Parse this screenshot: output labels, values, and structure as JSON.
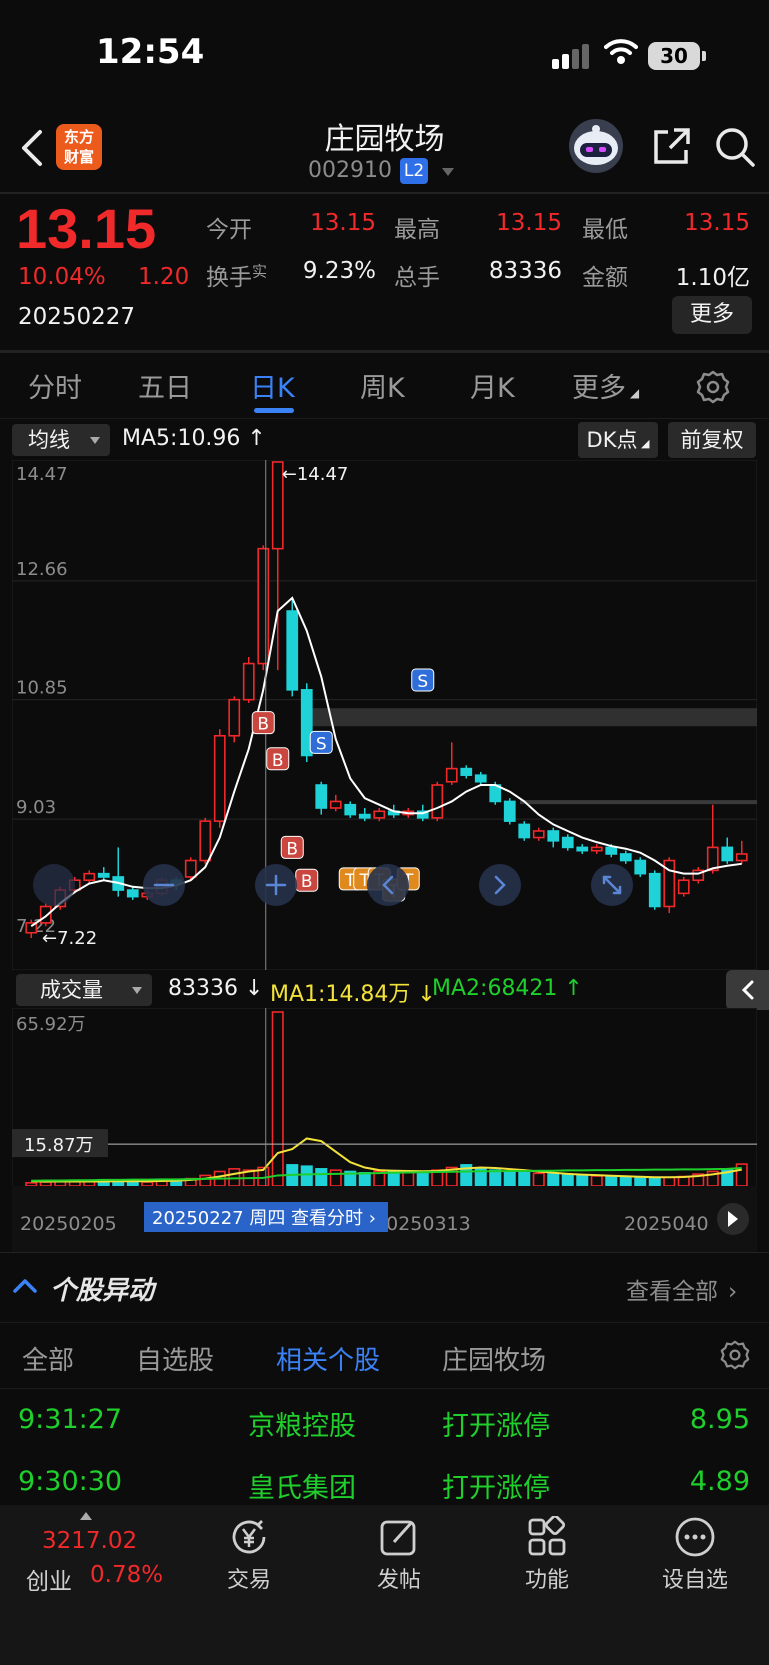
{
  "status_bar": {
    "time": "12:54",
    "battery": "30"
  },
  "header": {
    "logo_line1": "东方",
    "logo_line2": "财富",
    "title": "庄园牧场",
    "code": "002910",
    "level_badge": "L2"
  },
  "quote": {
    "price": "13.15",
    "change_pct": "10.04%",
    "change": "1.20",
    "date": "20250227",
    "fields": [
      {
        "label": "今开",
        "value": "13.15"
      },
      {
        "label": "最高",
        "value": "13.15"
      },
      {
        "label": "最低",
        "value": "13.15"
      },
      {
        "label": "换手",
        "label_sup": "实",
        "value": "9.23%"
      },
      {
        "label": "总手",
        "value": "83336"
      },
      {
        "label": "金额",
        "value": "1.10亿"
      }
    ],
    "more_label": "更多"
  },
  "tabs": [
    "分时",
    "五日",
    "日K",
    "周K",
    "月K",
    "更多"
  ],
  "active_tab": "日K",
  "kline": {
    "ma_selector": "均线",
    "ma5_label": "MA5:10.96 ↑",
    "dk_button": "DK点",
    "adjust_button": "前复权",
    "y_ticks": [
      "14.47",
      "12.66",
      "10.85",
      "9.03",
      "7.22"
    ],
    "high_marker": "14.47",
    "low_marker": "7.22",
    "signal_buy": "B",
    "signal_sell": "S",
    "signal_t": "T",
    "ma_color": "#ffffff"
  },
  "volume": {
    "selector": "成交量",
    "value": "83336 ↓",
    "ma1": "MA1:14.84万 ↓",
    "ma2": "MA2:68421 ↑",
    "y_top": "65.92万",
    "crosshair_value": "15.87万",
    "dates": [
      "20250205",
      "20250313",
      "2025040"
    ],
    "tooltip": "20250227 周四 查看分时",
    "ma1_color": "#f2e23a",
    "ma2_color": "#1fcf2c"
  },
  "colors": {
    "up": "#f0292a",
    "down": "#1ed2d8",
    "accent": "#3b82f6"
  },
  "chart_data": {
    "type": "candlestick",
    "title": "",
    "ylim": [
      7.22,
      14.47
    ],
    "x": [
      1,
      2,
      3,
      4,
      5,
      6,
      7,
      8,
      9,
      10,
      11,
      12,
      13,
      14,
      15,
      16,
      17,
      18,
      19,
      20,
      21,
      22,
      23,
      24,
      25,
      26,
      27,
      28,
      29,
      30,
      31,
      32,
      33,
      34,
      35,
      36,
      37,
      38,
      39,
      40,
      41,
      42,
      43,
      44,
      45,
      46,
      47,
      48,
      49,
      50
    ],
    "series": [
      {
        "name": "",
        "open": [
          7.3,
          7.45,
          7.7,
          7.95,
          8.1,
          8.2,
          8.15,
          7.95,
          7.85,
          7.9,
          8.1,
          8.15,
          8.4,
          9.0,
          10.3,
          10.85,
          11.4,
          13.15,
          12.2,
          11.0,
          9.55,
          9.2,
          9.25,
          9.1,
          9.05,
          9.15,
          9.1,
          9.15,
          9.05,
          9.6,
          9.8,
          9.7,
          9.55,
          9.3,
          8.95,
          8.75,
          8.85,
          8.75,
          8.6,
          8.55,
          8.6,
          8.5,
          8.4,
          8.2,
          7.7,
          7.9,
          8.1,
          8.25,
          8.6,
          8.4
        ],
        "close": [
          7.45,
          7.7,
          7.95,
          8.1,
          8.2,
          8.15,
          7.95,
          7.85,
          7.9,
          8.1,
          8.05,
          8.4,
          9.0,
          10.3,
          10.85,
          11.4,
          13.15,
          14.47,
          11.0,
          10.0,
          9.2,
          9.3,
          9.1,
          9.05,
          9.15,
          9.1,
          9.15,
          9.05,
          9.55,
          9.8,
          9.7,
          9.6,
          9.3,
          9.0,
          8.75,
          8.85,
          8.7,
          8.6,
          8.55,
          8.6,
          8.5,
          8.4,
          8.2,
          7.7,
          8.4,
          8.1,
          8.25,
          8.6,
          8.4,
          8.5
        ],
        "high": [
          7.5,
          7.75,
          8.0,
          8.15,
          8.25,
          8.3,
          8.6,
          8.0,
          7.95,
          8.15,
          8.15,
          8.45,
          9.05,
          10.4,
          10.9,
          11.5,
          13.2,
          14.47,
          12.4,
          11.1,
          9.6,
          9.4,
          9.3,
          9.2,
          9.2,
          9.25,
          9.2,
          9.25,
          9.6,
          10.2,
          9.85,
          9.75,
          9.6,
          9.35,
          9.0,
          8.9,
          8.9,
          8.8,
          8.65,
          8.65,
          8.65,
          8.55,
          8.45,
          8.25,
          8.45,
          8.15,
          8.3,
          9.25,
          8.75,
          8.7
        ],
        "low": [
          7.22,
          7.4,
          7.65,
          7.9,
          8.05,
          8.1,
          7.85,
          7.8,
          7.8,
          7.85,
          7.95,
          8.1,
          8.35,
          8.9,
          10.2,
          10.8,
          11.3,
          11.3,
          10.9,
          9.9,
          9.1,
          9.15,
          9.05,
          9.0,
          9.0,
          9.05,
          9.05,
          9.0,
          9.0,
          9.55,
          9.65,
          9.55,
          9.25,
          8.95,
          8.7,
          8.7,
          8.6,
          8.55,
          8.5,
          8.5,
          8.45,
          8.35,
          8.15,
          7.65,
          7.6,
          7.85,
          8.05,
          8.2,
          8.35,
          8.35
        ]
      }
    ],
    "ma5": [
      7.4,
      7.55,
      7.75,
      7.92,
      8.05,
      8.1,
      8.06,
      8.0,
      7.98,
      7.98,
      8.02,
      8.1,
      8.3,
      8.75,
      9.45,
      10.1,
      11.0,
      12.2,
      12.4,
      11.9,
      11.2,
      10.25,
      9.65,
      9.35,
      9.25,
      9.15,
      9.12,
      9.12,
      9.2,
      9.3,
      9.45,
      9.55,
      9.55,
      9.45,
      9.3,
      9.1,
      8.95,
      8.85,
      8.75,
      8.68,
      8.62,
      8.58,
      8.52,
      8.4,
      8.25,
      8.2,
      8.2,
      8.28,
      8.32,
      8.35
    ],
    "volume": [
      1.2,
      1.5,
      1.8,
      1.6,
      2.0,
      1.9,
      1.7,
      1.3,
      1.5,
      1.8,
      2.2,
      2.8,
      4.0,
      5.5,
      6.5,
      6.0,
      7.0,
      65.92,
      8.0,
      7.5,
      6.5,
      6.0,
      5.5,
      5.0,
      5.6,
      5.8,
      5.5,
      5.2,
      6.0,
      7.0,
      8.0,
      6.5,
      6.0,
      5.5,
      5.0,
      4.8,
      4.5,
      4.2,
      4.0,
      3.8,
      3.6,
      3.5,
      3.2,
      3.0,
      3.3,
      3.6,
      4.5,
      5.5,
      6.5,
      8.3
    ],
    "volume_ma1": [
      1.8,
      1.7,
      1.7,
      1.7,
      1.7,
      1.7,
      1.8,
      1.8,
      1.8,
      1.9,
      2.0,
      2.3,
      2.8,
      3.6,
      4.6,
      5.5,
      6.1,
      12.5,
      14.0,
      18.0,
      17.0,
      13.0,
      9.0,
      7.0,
      6.0,
      5.8,
      5.7,
      5.6,
      5.7,
      6.2,
      6.7,
      7.0,
      6.8,
      6.4,
      6.0,
      5.5,
      5.0,
      4.6,
      4.3,
      4.1,
      3.9,
      3.7,
      3.5,
      3.3,
      3.3,
      3.4,
      3.8,
      4.4,
      5.2,
      6.2
    ],
    "volume_ma2": [
      2.0,
      2.1,
      2.1,
      2.2,
      2.2,
      2.3,
      2.3,
      2.4,
      2.4,
      2.5,
      2.5,
      2.6,
      2.7,
      2.8,
      2.9,
      3.0,
      3.1,
      4.0,
      4.2,
      4.4,
      4.5,
      4.6,
      4.7,
      4.8,
      4.9,
      5.0,
      5.1,
      5.2,
      5.3,
      5.4,
      5.5,
      5.6,
      5.6,
      5.7,
      5.7,
      5.8,
      5.8,
      5.9,
      5.9,
      6.0,
      6.0,
      6.1,
      6.1,
      6.2,
      6.2,
      6.3,
      6.3,
      6.4,
      6.5,
      6.8
    ]
  },
  "movement": {
    "title": "个股异动",
    "view_all": "查看全部",
    "subtabs": [
      "全部",
      "自选股",
      "相关个股",
      "庄园牧场"
    ],
    "active_subtab": "相关个股",
    "rows": [
      {
        "time": "9:31:27",
        "name": "京粮控股",
        "event": "打开涨停",
        "value": "8.95"
      },
      {
        "time": "9:30:30",
        "name": "皇氏集团",
        "event": "打开涨停",
        "value": "4.89"
      }
    ]
  },
  "bottom_bar": {
    "index_value": "3217.02",
    "index_name": "创业",
    "index_change": "0.78%",
    "items": [
      {
        "label": "交易",
        "icon": "yen-icon"
      },
      {
        "label": "发帖",
        "icon": "edit-icon"
      },
      {
        "label": "功能",
        "icon": "grid-icon"
      },
      {
        "label": "设自选",
        "icon": "more-icon"
      }
    ]
  }
}
